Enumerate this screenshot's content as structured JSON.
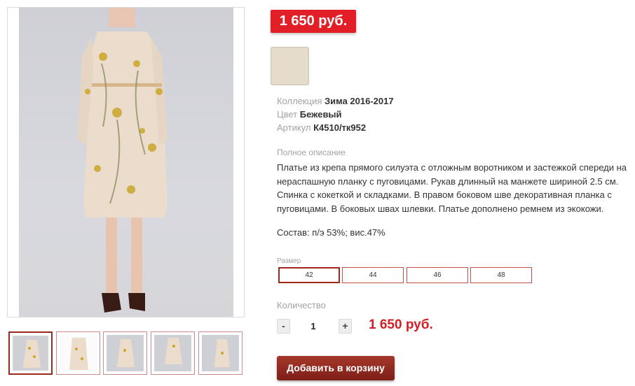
{
  "product": {
    "price_badge": "1 650 руб.",
    "swatch_color": "#e6dccc",
    "attributes": [
      {
        "key": "Коллекция",
        "value": "Зима 2016-2017"
      },
      {
        "key": "Цвет",
        "value": "Бежевый"
      },
      {
        "key": "Артикул",
        "value": "К4510/тк952"
      }
    ],
    "description_label": "Полное описание",
    "description": "Платье из крепа прямого силуэта с отложным воротником и застежкой спереди на нераспашную планку с пуговицами. Рукав длинный на манжете шириной 2.5 см. Спинка с кокеткой и складками. В правом боковом шве декоративная планка с пуговицами. В боковых швах шлевки. Платье дополнено ремнем из экокожи.",
    "composition": "Состав: п/э 53%; вис.47%"
  },
  "size": {
    "label": "Размер",
    "options": [
      "42",
      "44",
      "46",
      "48"
    ],
    "selected": "42"
  },
  "quantity": {
    "label": "Количество",
    "minus": "-",
    "plus": "+",
    "value": "1",
    "total": "1 650 руб."
  },
  "cart": {
    "add_label": "Добавить в корзину"
  },
  "colors": {
    "accent_red": "#e21f26",
    "button_dark_red": "#8f2a20"
  }
}
